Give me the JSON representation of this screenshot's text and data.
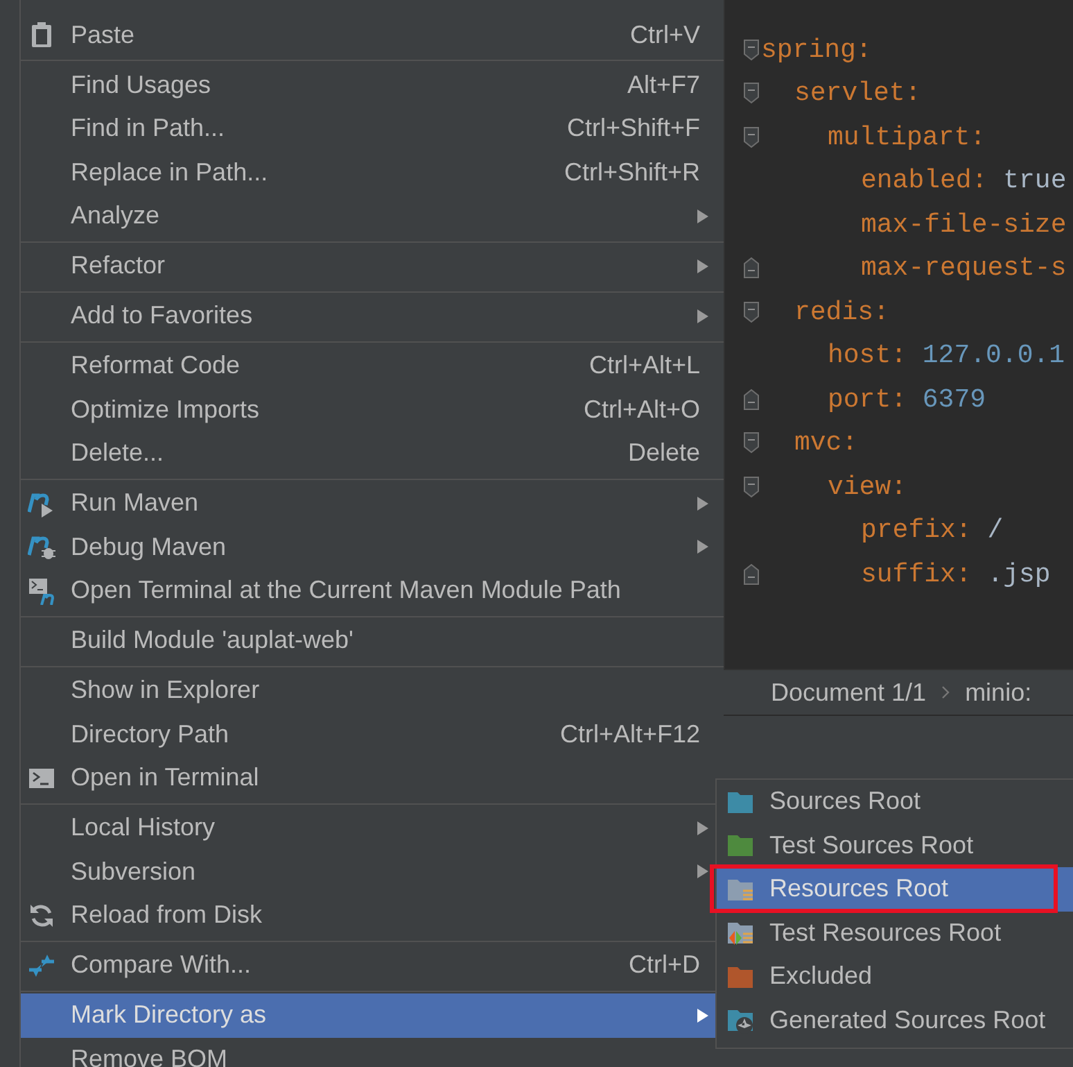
{
  "editor": {
    "lines": [
      {
        "key": "spring:",
        "children": [
          {
            "key": "servlet:",
            "children": [
              {
                "key": "multipart:",
                "children": [
                  {
                    "key": "enabled:",
                    "value": "true",
                    "kind": "string"
                  },
                  {
                    "key": "max-file-size"
                  },
                  {
                    "key": "max-request-s"
                  }
                ]
              }
            ]
          },
          {
            "key": "redis:",
            "children": [
              {
                "key": "host:",
                "value": "127.0.0.1",
                "kind": "number"
              },
              {
                "key": "port:",
                "value": "6379",
                "kind": "number"
              }
            ]
          },
          {
            "key": "mvc:",
            "children": [
              {
                "key": "view:",
                "children": [
                  {
                    "key": "prefix:",
                    "value": "/",
                    "kind": "string"
                  },
                  {
                    "key": "suffix:",
                    "value": ".jsp",
                    "kind": "string"
                  }
                ]
              }
            ]
          }
        ]
      }
    ]
  },
  "breadcrumb": [
    "Document 1/1",
    "minio:"
  ],
  "context_menu": {
    "groups": [
      [
        {
          "label": "Paste",
          "kind": "paste",
          "shortcut": "Ctrl+V",
          "submenu": false,
          "selected": false
        }
      ],
      [
        {
          "label": "Find Usages",
          "kind": "plain",
          "shortcut": "Alt+F7",
          "submenu": false,
          "selected": false
        },
        {
          "label": "Find in Path...",
          "kind": "plain",
          "shortcut": "Ctrl+Shift+F",
          "submenu": false,
          "selected": false
        },
        {
          "label": "Replace in Path...",
          "kind": "plain",
          "shortcut": "Ctrl+Shift+R",
          "submenu": false,
          "selected": false
        },
        {
          "label": "Analyze",
          "kind": "plain",
          "submenu": true,
          "selected": false
        }
      ],
      [
        {
          "label": "Refactor",
          "kind": "plain",
          "submenu": true,
          "selected": false
        }
      ],
      [
        {
          "label": "Add to Favorites",
          "kind": "plain",
          "submenu": true,
          "selected": false
        }
      ],
      [
        {
          "label": "Reformat Code",
          "kind": "plain",
          "shortcut": "Ctrl+Alt+L",
          "submenu": false,
          "selected": false
        },
        {
          "label": "Optimize Imports",
          "kind": "plain",
          "shortcut": "Ctrl+Alt+O",
          "submenu": false,
          "selected": false
        },
        {
          "label": "Delete...",
          "kind": "plain",
          "shortcut": "Delete",
          "submenu": false,
          "selected": false
        }
      ],
      [
        {
          "label": "Run Maven",
          "kind": "runmaven",
          "submenu": true,
          "selected": false
        },
        {
          "label": "Debug Maven",
          "kind": "debugmaven",
          "submenu": true,
          "selected": false
        },
        {
          "label": "Open Terminal at the Current Maven Module Path",
          "kind": "mvnterminal",
          "submenu": false,
          "selected": false
        }
      ],
      [
        {
          "label": "Build Module 'auplat-web'",
          "kind": "plain",
          "submenu": false,
          "selected": false
        }
      ],
      [
        {
          "label": "Show in Explorer",
          "kind": "plain",
          "submenu": false,
          "selected": false
        },
        {
          "label": "Directory Path",
          "kind": "plain",
          "shortcut": "Ctrl+Alt+F12",
          "submenu": false,
          "selected": false
        },
        {
          "label": "Open in Terminal",
          "kind": "terminal",
          "submenu": false,
          "selected": false
        }
      ],
      [
        {
          "label": "Local History",
          "kind": "plain",
          "submenu": true,
          "selected": false
        },
        {
          "label": "Subversion",
          "kind": "plain",
          "submenu": true,
          "selected": false
        },
        {
          "label": "Reload from Disk",
          "kind": "reload",
          "submenu": false,
          "selected": false
        }
      ],
      [
        {
          "label": "Compare With...",
          "kind": "compare",
          "shortcut": "Ctrl+D",
          "submenu": false,
          "selected": false
        }
      ],
      [
        {
          "label": "Mark Directory as",
          "kind": "plain",
          "submenu": true,
          "selected": true
        },
        {
          "label": "Remove BOM",
          "kind": "plain",
          "submenu": false,
          "selected": false
        }
      ]
    ]
  },
  "submenu": {
    "items": [
      {
        "label": "Sources Root",
        "kind": "sources",
        "selected": false,
        "outlined": false
      },
      {
        "label": "Test Sources Root",
        "kind": "testsources",
        "selected": false,
        "outlined": false
      },
      {
        "label": "Resources Root",
        "kind": "resources",
        "selected": true,
        "outlined": true
      },
      {
        "label": "Test Resources Root",
        "kind": "testresources",
        "selected": false,
        "outlined": false
      },
      {
        "label": "Excluded",
        "kind": "excluded",
        "selected": false,
        "outlined": false
      },
      {
        "label": "Generated Sources Root",
        "kind": "generated",
        "selected": false,
        "outlined": false
      }
    ]
  }
}
